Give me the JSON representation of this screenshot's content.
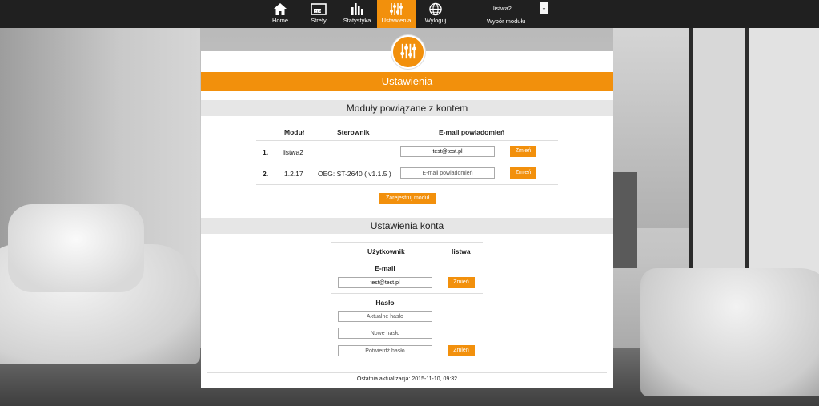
{
  "nav": {
    "items": [
      {
        "label": "Home",
        "icon": "home-icon"
      },
      {
        "label": "Strefy",
        "icon": "zones-icon"
      },
      {
        "label": "Statystyka",
        "icon": "statistics-icon"
      },
      {
        "label": "Ustawienia",
        "icon": "settings-sliders-icon",
        "active": true
      },
      {
        "label": "Wyloguj",
        "icon": "globe-icon"
      }
    ],
    "module_select": {
      "value": "listwa2",
      "label": "Wybór modułu"
    }
  },
  "colors": {
    "accent": "#f2900c",
    "nav_bg": "#202020",
    "section_bg": "#e6e6e6"
  },
  "panel": {
    "title": "Ustawienia",
    "modules": {
      "heading": "Moduły powiązane z kontem",
      "columns": [
        "Moduł",
        "Sterownik",
        "E-mail powiadomień"
      ],
      "rows": [
        {
          "num": "1.",
          "module": "listwa2",
          "controller": "",
          "email_value": "test@test.pl",
          "email_placeholder": "",
          "button": "Zmień"
        },
        {
          "num": "2.",
          "module": "1.2.17",
          "controller": "OEG: ST-2640 ( v1.1.5 )",
          "email_value": "",
          "email_placeholder": "E-mail powiadomień",
          "button": "Zmień"
        }
      ],
      "register_button": "Zarejestruj moduł"
    },
    "account": {
      "heading": "Ustawienia konta",
      "user_label": "Użytkownik",
      "user_value": "listwa",
      "email_label": "E-mail",
      "email_value": "test@test.pl",
      "email_button": "Zmień",
      "password_label": "Hasło",
      "current_password_placeholder": "Aktualne hasło",
      "new_password_placeholder": "Nowe hasło",
      "confirm_password_placeholder": "Potwierdź hasło",
      "password_button": "Zmień"
    },
    "footer": "Ostatnia aktualizacja: 2015-11-10, 09:32"
  }
}
